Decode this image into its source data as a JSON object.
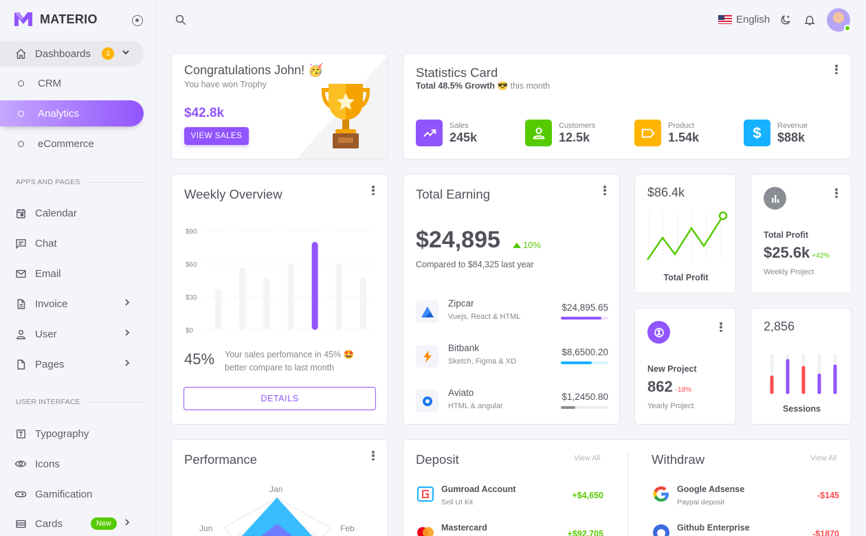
{
  "brand": {
    "name": "MATERIO",
    "color": "#9155fd"
  },
  "sidebar": {
    "dashboards": {
      "label": "Dashboards",
      "badge": "3"
    },
    "sub_items": [
      {
        "label": "CRM"
      },
      {
        "label": "Analytics",
        "active": true
      },
      {
        "label": "eCommerce"
      }
    ],
    "section_apps": "APPS AND PAGES",
    "apps": [
      {
        "label": "Calendar",
        "icon": "calendar-icon"
      },
      {
        "label": "Chat",
        "icon": "chat-icon"
      },
      {
        "label": "Email",
        "icon": "email-icon"
      },
      {
        "label": "Invoice",
        "icon": "invoice-icon",
        "has_children": true
      },
      {
        "label": "User",
        "icon": "user-icon",
        "has_children": true
      },
      {
        "label": "Pages",
        "icon": "pages-icon",
        "has_children": true
      }
    ],
    "section_ui": "USER INTERFACE",
    "ui": [
      {
        "label": "Typography",
        "icon": "typography-icon"
      },
      {
        "label": "Icons",
        "icon": "eye-icon"
      },
      {
        "label": "Gamification",
        "icon": "gamepad-icon"
      },
      {
        "label": "Cards",
        "icon": "cards-icon",
        "badge": "New",
        "has_children": true
      }
    ]
  },
  "topbar": {
    "language": "English"
  },
  "congrats": {
    "title": "Congratulations John! 🥳",
    "subtitle": "You have won Trophy",
    "amount": "$42.8k",
    "button": "VIEW SALES"
  },
  "statistics": {
    "title": "Statistics Card",
    "growth_bold": "Total 48.5% Growth 😎",
    "growth_rest": "this month",
    "items": [
      {
        "label": "Sales",
        "value": "245k",
        "color": "#9155fd",
        "icon": "trending-up-icon"
      },
      {
        "label": "Customers",
        "value": "12.5k",
        "color": "#56ca00",
        "icon": "account-icon"
      },
      {
        "label": "Product",
        "value": "1.54k",
        "color": "#ffb400",
        "icon": "label-icon"
      },
      {
        "label": "Revenue",
        "value": "$88k",
        "color": "#16b1ff",
        "icon": "dollar-icon"
      }
    ]
  },
  "weekly": {
    "title": "Weekly Overview",
    "y_ticks": [
      "$90",
      "$60",
      "$30",
      "$0"
    ],
    "percent": "45%",
    "description": "Your sales perfomance in 45% 🤩 better compare to last month",
    "button": "DETAILS"
  },
  "chart_data": {
    "type": "bar",
    "categories": [
      "",
      "",
      "",
      "",
      "",
      "",
      ""
    ],
    "values": [
      37,
      57,
      48,
      60,
      80,
      60,
      48
    ],
    "highlight_index": 4,
    "ylim": [
      0,
      90
    ],
    "y_ticks": [
      "$90",
      "$60",
      "$30",
      "$0"
    ]
  },
  "earning": {
    "title": "Total Earning",
    "amount": "$24,895",
    "change": "10%",
    "compare": "Compared to $84,325 last year",
    "items": [
      {
        "name": "Zipcar",
        "sub": "Vuejs, React & HTML",
        "amount": "$24,895.65",
        "progress": 0.85,
        "color": "#9155fd",
        "track": "#ede4fe"
      },
      {
        "name": "Bitbank",
        "sub": "Sketch, Figma & XD",
        "amount": "$8,6500.20",
        "progress": 0.65,
        "color": "#16b1ff",
        "track": "#d8f1ff"
      },
      {
        "name": "Aviato",
        "sub": "HTML & angular",
        "amount": "$1,2450.80",
        "progress": 0.3,
        "color": "#8a8d93",
        "track": "#ececee"
      }
    ]
  },
  "profit_line": {
    "value": "$86.4k",
    "label": "Total Profit"
  },
  "total_profit": {
    "label": "Total Profit",
    "value": "$25.6k",
    "change": "+42%",
    "sub": "Weekly Project"
  },
  "new_project": {
    "label": "New Project",
    "value": "862",
    "change": "-18%",
    "sub": "Yearly Project"
  },
  "sessions": {
    "value": "2,856",
    "label": "Sessions"
  },
  "performance": {
    "title": "Performance",
    "labels": [
      "Jan",
      "Feb",
      "Jun"
    ]
  },
  "deposit": {
    "title": "Deposit",
    "view_all": "View All",
    "items": [
      {
        "name": "Gumroad Account",
        "sub": "Sell UI Kit",
        "amount": "+$4,650"
      },
      {
        "name": "Mastercard",
        "sub": "",
        "amount": "+$92,705"
      }
    ]
  },
  "withdraw": {
    "title": "Withdraw",
    "view_all": "View All",
    "items": [
      {
        "name": "Google Adsense",
        "sub": "Paypal deposit",
        "amount": "-$145"
      },
      {
        "name": "Github Enterprise",
        "sub": "",
        "amount": "-$1870"
      }
    ]
  }
}
